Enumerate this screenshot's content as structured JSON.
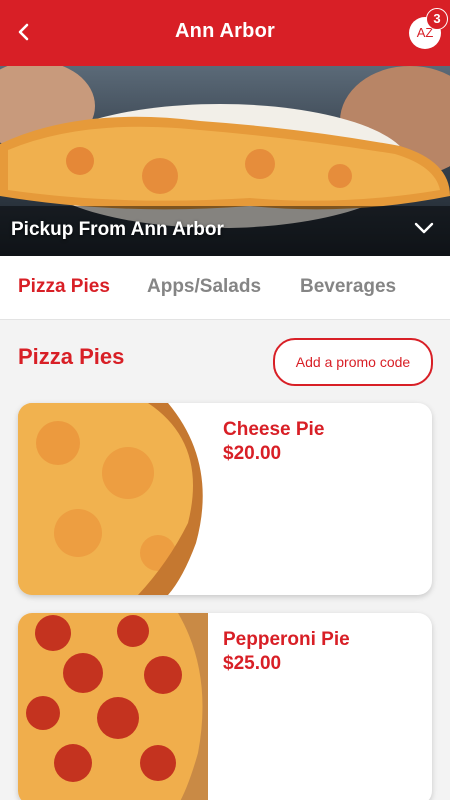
{
  "header": {
    "title": "Ann Arbor",
    "avatar_initials": "AZ",
    "cart_count": "3",
    "back_icon": "back-arrow-icon"
  },
  "hero": {
    "caption": "Pickup From Ann Arbor",
    "toggle_icon": "chevron-down-icon"
  },
  "tabs": [
    {
      "label": "Pizza Pies",
      "active": true
    },
    {
      "label": "Apps/Salads",
      "active": false
    },
    {
      "label": "Beverages",
      "active": false
    }
  ],
  "section": {
    "title": "Pizza Pies",
    "promo_label": "Add a promo code"
  },
  "items": [
    {
      "name": "Cheese Pie",
      "price": "$20.00"
    },
    {
      "name": "Pepperoni Pie",
      "price": "$25.00"
    }
  ],
  "colors": {
    "brand": "#d81f26",
    "tab_inactive": "#858585",
    "background": "#f3f3f3"
  }
}
